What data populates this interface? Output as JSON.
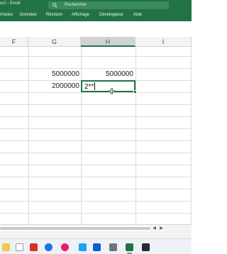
{
  "titlebar": {
    "title": "ur1 - Excel",
    "search_placeholder": "Rechercher",
    "accent_color": "#217346"
  },
  "ribbon": {
    "tabs": [
      {
        "label": "rmules"
      },
      {
        "label": "Données"
      },
      {
        "label": "Révision"
      },
      {
        "label": "Affichage"
      },
      {
        "label": "Développeur"
      },
      {
        "label": "Aide"
      }
    ]
  },
  "sheet": {
    "columns": [
      {
        "label": "F",
        "selected": false
      },
      {
        "label": "G",
        "selected": false
      },
      {
        "label": "H",
        "selected": true
      },
      {
        "label": "I",
        "selected": false
      }
    ],
    "cells": {
      "g1": "5000000",
      "h1": "5000000",
      "g2": "2000000",
      "h2_editing": "2**"
    },
    "active_cell_column": "H"
  },
  "taskbar": {
    "icons": [
      "file-explorer-icon",
      "pdf-reader-icon",
      "edge-browser-icon",
      "photos-icon",
      "snipping-tool-icon",
      "outlook-icon",
      "store-icon",
      "excel-icon",
      "terminal-icon"
    ],
    "active_app": "excel-icon"
  }
}
